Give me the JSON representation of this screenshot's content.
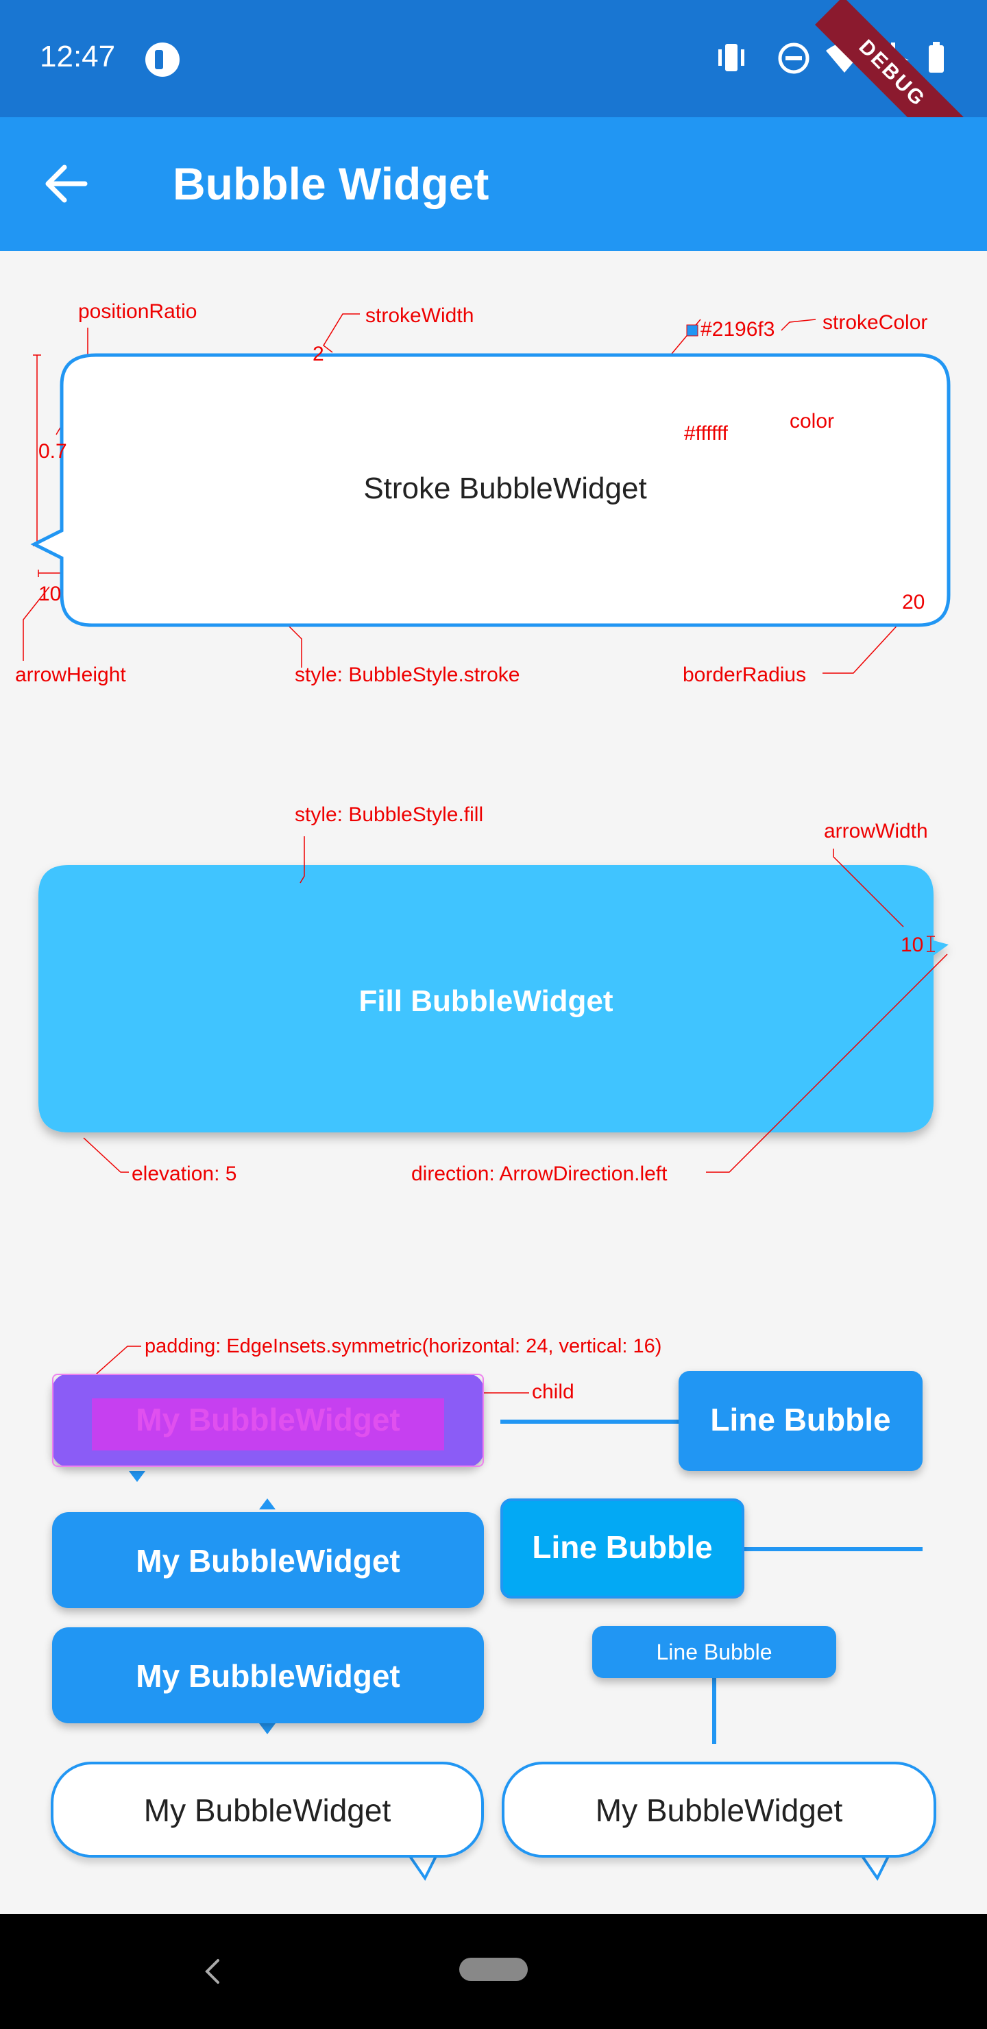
{
  "status_bar": {
    "time": "12:47",
    "debug_label": "DEBUG",
    "background": "#1976d2"
  },
  "app_bar": {
    "title": "Bubble Widget",
    "background": "#2196f3"
  },
  "stroke_section": {
    "bubble_label": "Stroke BubbleWidget",
    "ann": {
      "position_ratio_name": "positionRatio",
      "position_ratio_value": "0.7",
      "stroke_width_name": "strokeWidth",
      "stroke_width_value": "2",
      "stroke_color_value": "#2196f3",
      "stroke_color_name": "strokeColor",
      "color_value": "#ffffff",
      "color_name": "color",
      "arrow_height_value": "10",
      "arrow_height_name": "arrowHeight",
      "style": "style: BubbleStyle.stroke",
      "border_radius_value": "20",
      "border_radius_name": "borderRadius"
    }
  },
  "fill_section": {
    "bubble_label": "Fill BubbleWidget",
    "ann": {
      "style": "style: BubbleStyle.fill",
      "arrow_width_name": "arrowWidth",
      "arrow_width_value": "10",
      "elevation": "elevation: 5",
      "direction": "direction: ArrowDirection.left"
    }
  },
  "examples": {
    "padding_annotation": "padding: EdgeInsets.symmetric(horizontal: 24, vertical: 16)",
    "child_annotation": "child",
    "my_bubble": "My BubbleWidget",
    "line_bubble": "Line Bubble",
    "line_bubble_small": "Line Bubble"
  },
  "colors": {
    "blue": "#2196f3",
    "light_blue": "#40c4ff",
    "cyan": "#03a9f4",
    "purple_overlay": "#8b5cf6",
    "annotation": "#ee0000"
  }
}
